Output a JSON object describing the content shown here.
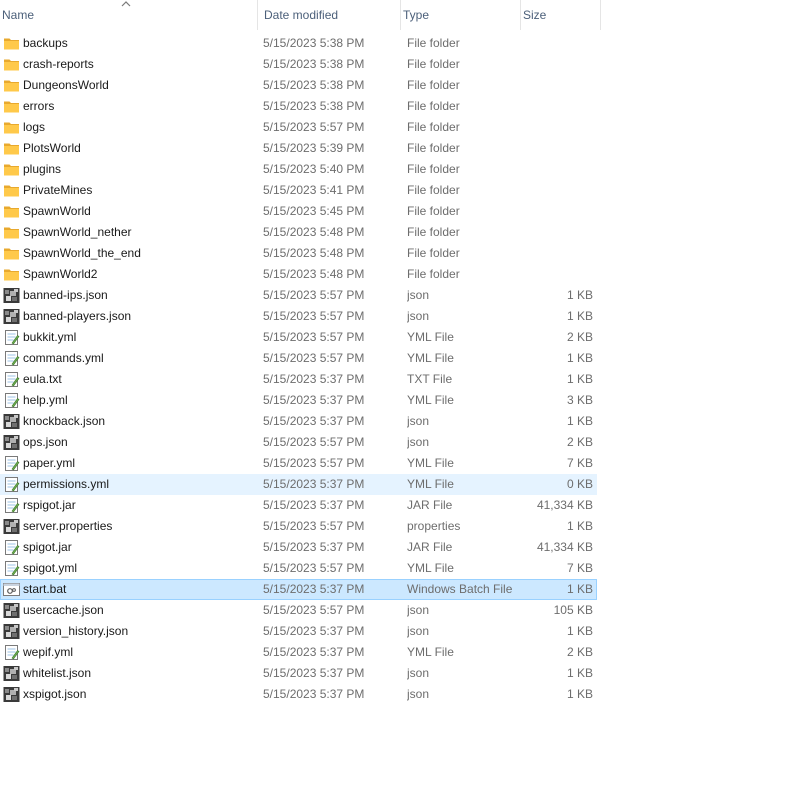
{
  "columns": {
    "name": "Name",
    "date": "Date modified",
    "type": "Type",
    "size": "Size"
  },
  "sort": {
    "column": "name",
    "direction": "ascending",
    "icon": "sort-up-icon"
  },
  "colors": {
    "header_text": "#4c607a",
    "folder": "#ffc94a",
    "hover_bg": "#e5f3ff",
    "selected_bg": "#cce8ff",
    "selected_border": "#99d1ff"
  },
  "files": [
    {
      "name": "backups",
      "date": "5/15/2023 5:38 PM",
      "type": "File folder",
      "size": "",
      "icon": "folder-icon"
    },
    {
      "name": "crash-reports",
      "date": "5/15/2023 5:38 PM",
      "type": "File folder",
      "size": "",
      "icon": "folder-icon"
    },
    {
      "name": "DungeonsWorld",
      "date": "5/15/2023 5:38 PM",
      "type": "File folder",
      "size": "",
      "icon": "folder-icon"
    },
    {
      "name": "errors",
      "date": "5/15/2023 5:38 PM",
      "type": "File folder",
      "size": "",
      "icon": "folder-icon"
    },
    {
      "name": "logs",
      "date": "5/15/2023 5:57 PM",
      "type": "File folder",
      "size": "",
      "icon": "folder-icon"
    },
    {
      "name": "PlotsWorld",
      "date": "5/15/2023 5:39 PM",
      "type": "File folder",
      "size": "",
      "icon": "folder-icon"
    },
    {
      "name": "plugins",
      "date": "5/15/2023 5:40 PM",
      "type": "File folder",
      "size": "",
      "icon": "folder-icon"
    },
    {
      "name": "PrivateMines",
      "date": "5/15/2023 5:41 PM",
      "type": "File folder",
      "size": "",
      "icon": "folder-icon"
    },
    {
      "name": "SpawnWorld",
      "date": "5/15/2023 5:45 PM",
      "type": "File folder",
      "size": "",
      "icon": "folder-icon"
    },
    {
      "name": "SpawnWorld_nether",
      "date": "5/15/2023 5:48 PM",
      "type": "File folder",
      "size": "",
      "icon": "folder-icon"
    },
    {
      "name": "SpawnWorld_the_end",
      "date": "5/15/2023 5:48 PM",
      "type": "File folder",
      "size": "",
      "icon": "folder-icon"
    },
    {
      "name": "SpawnWorld2",
      "date": "5/15/2023 5:48 PM",
      "type": "File folder",
      "size": "",
      "icon": "folder-icon"
    },
    {
      "name": "banned-ips.json",
      "date": "5/15/2023 5:57 PM",
      "type": "json",
      "size": "1 KB",
      "icon": "json-file-icon"
    },
    {
      "name": "banned-players.json",
      "date": "5/15/2023 5:57 PM",
      "type": "json",
      "size": "1 KB",
      "icon": "json-file-icon"
    },
    {
      "name": "bukkit.yml",
      "date": "5/15/2023 5:57 PM",
      "type": "YML File",
      "size": "2 KB",
      "icon": "notepad-file-icon"
    },
    {
      "name": "commands.yml",
      "date": "5/15/2023 5:57 PM",
      "type": "YML File",
      "size": "1 KB",
      "icon": "notepad-file-icon"
    },
    {
      "name": "eula.txt",
      "date": "5/15/2023 5:37 PM",
      "type": "TXT File",
      "size": "1 KB",
      "icon": "notepad-file-icon"
    },
    {
      "name": "help.yml",
      "date": "5/15/2023 5:37 PM",
      "type": "YML File",
      "size": "3 KB",
      "icon": "notepad-file-icon"
    },
    {
      "name": "knockback.json",
      "date": "5/15/2023 5:37 PM",
      "type": "json",
      "size": "1 KB",
      "icon": "json-file-icon"
    },
    {
      "name": "ops.json",
      "date": "5/15/2023 5:57 PM",
      "type": "json",
      "size": "2 KB",
      "icon": "json-file-icon"
    },
    {
      "name": "paper.yml",
      "date": "5/15/2023 5:57 PM",
      "type": "YML File",
      "size": "7 KB",
      "icon": "notepad-file-icon"
    },
    {
      "name": "permissions.yml",
      "date": "5/15/2023 5:37 PM",
      "type": "YML File",
      "size": "0 KB",
      "icon": "notepad-file-icon",
      "state": "hover"
    },
    {
      "name": "rspigot.jar",
      "date": "5/15/2023 5:37 PM",
      "type": "JAR File",
      "size": "41,334 KB",
      "icon": "notepad-file-icon"
    },
    {
      "name": "server.properties",
      "date": "5/15/2023 5:57 PM",
      "type": "properties",
      "size": "1 KB",
      "icon": "json-file-icon"
    },
    {
      "name": "spigot.jar",
      "date": "5/15/2023 5:37 PM",
      "type": "JAR File",
      "size": "41,334 KB",
      "icon": "notepad-file-icon"
    },
    {
      "name": "spigot.yml",
      "date": "5/15/2023 5:57 PM",
      "type": "YML File",
      "size": "7 KB",
      "icon": "notepad-file-icon"
    },
    {
      "name": "start.bat",
      "date": "5/15/2023 5:37 PM",
      "type": "Windows Batch File",
      "size": "1 KB",
      "icon": "batch-file-icon",
      "state": "selected"
    },
    {
      "name": "usercache.json",
      "date": "5/15/2023 5:57 PM",
      "type": "json",
      "size": "105 KB",
      "icon": "json-file-icon"
    },
    {
      "name": "version_history.json",
      "date": "5/15/2023 5:37 PM",
      "type": "json",
      "size": "1 KB",
      "icon": "json-file-icon"
    },
    {
      "name": "wepif.yml",
      "date": "5/15/2023 5:37 PM",
      "type": "YML File",
      "size": "2 KB",
      "icon": "notepad-file-icon"
    },
    {
      "name": "whitelist.json",
      "date": "5/15/2023 5:37 PM",
      "type": "json",
      "size": "1 KB",
      "icon": "json-file-icon"
    },
    {
      "name": "xspigot.json",
      "date": "5/15/2023 5:37 PM",
      "type": "json",
      "size": "1 KB",
      "icon": "json-file-icon"
    }
  ]
}
